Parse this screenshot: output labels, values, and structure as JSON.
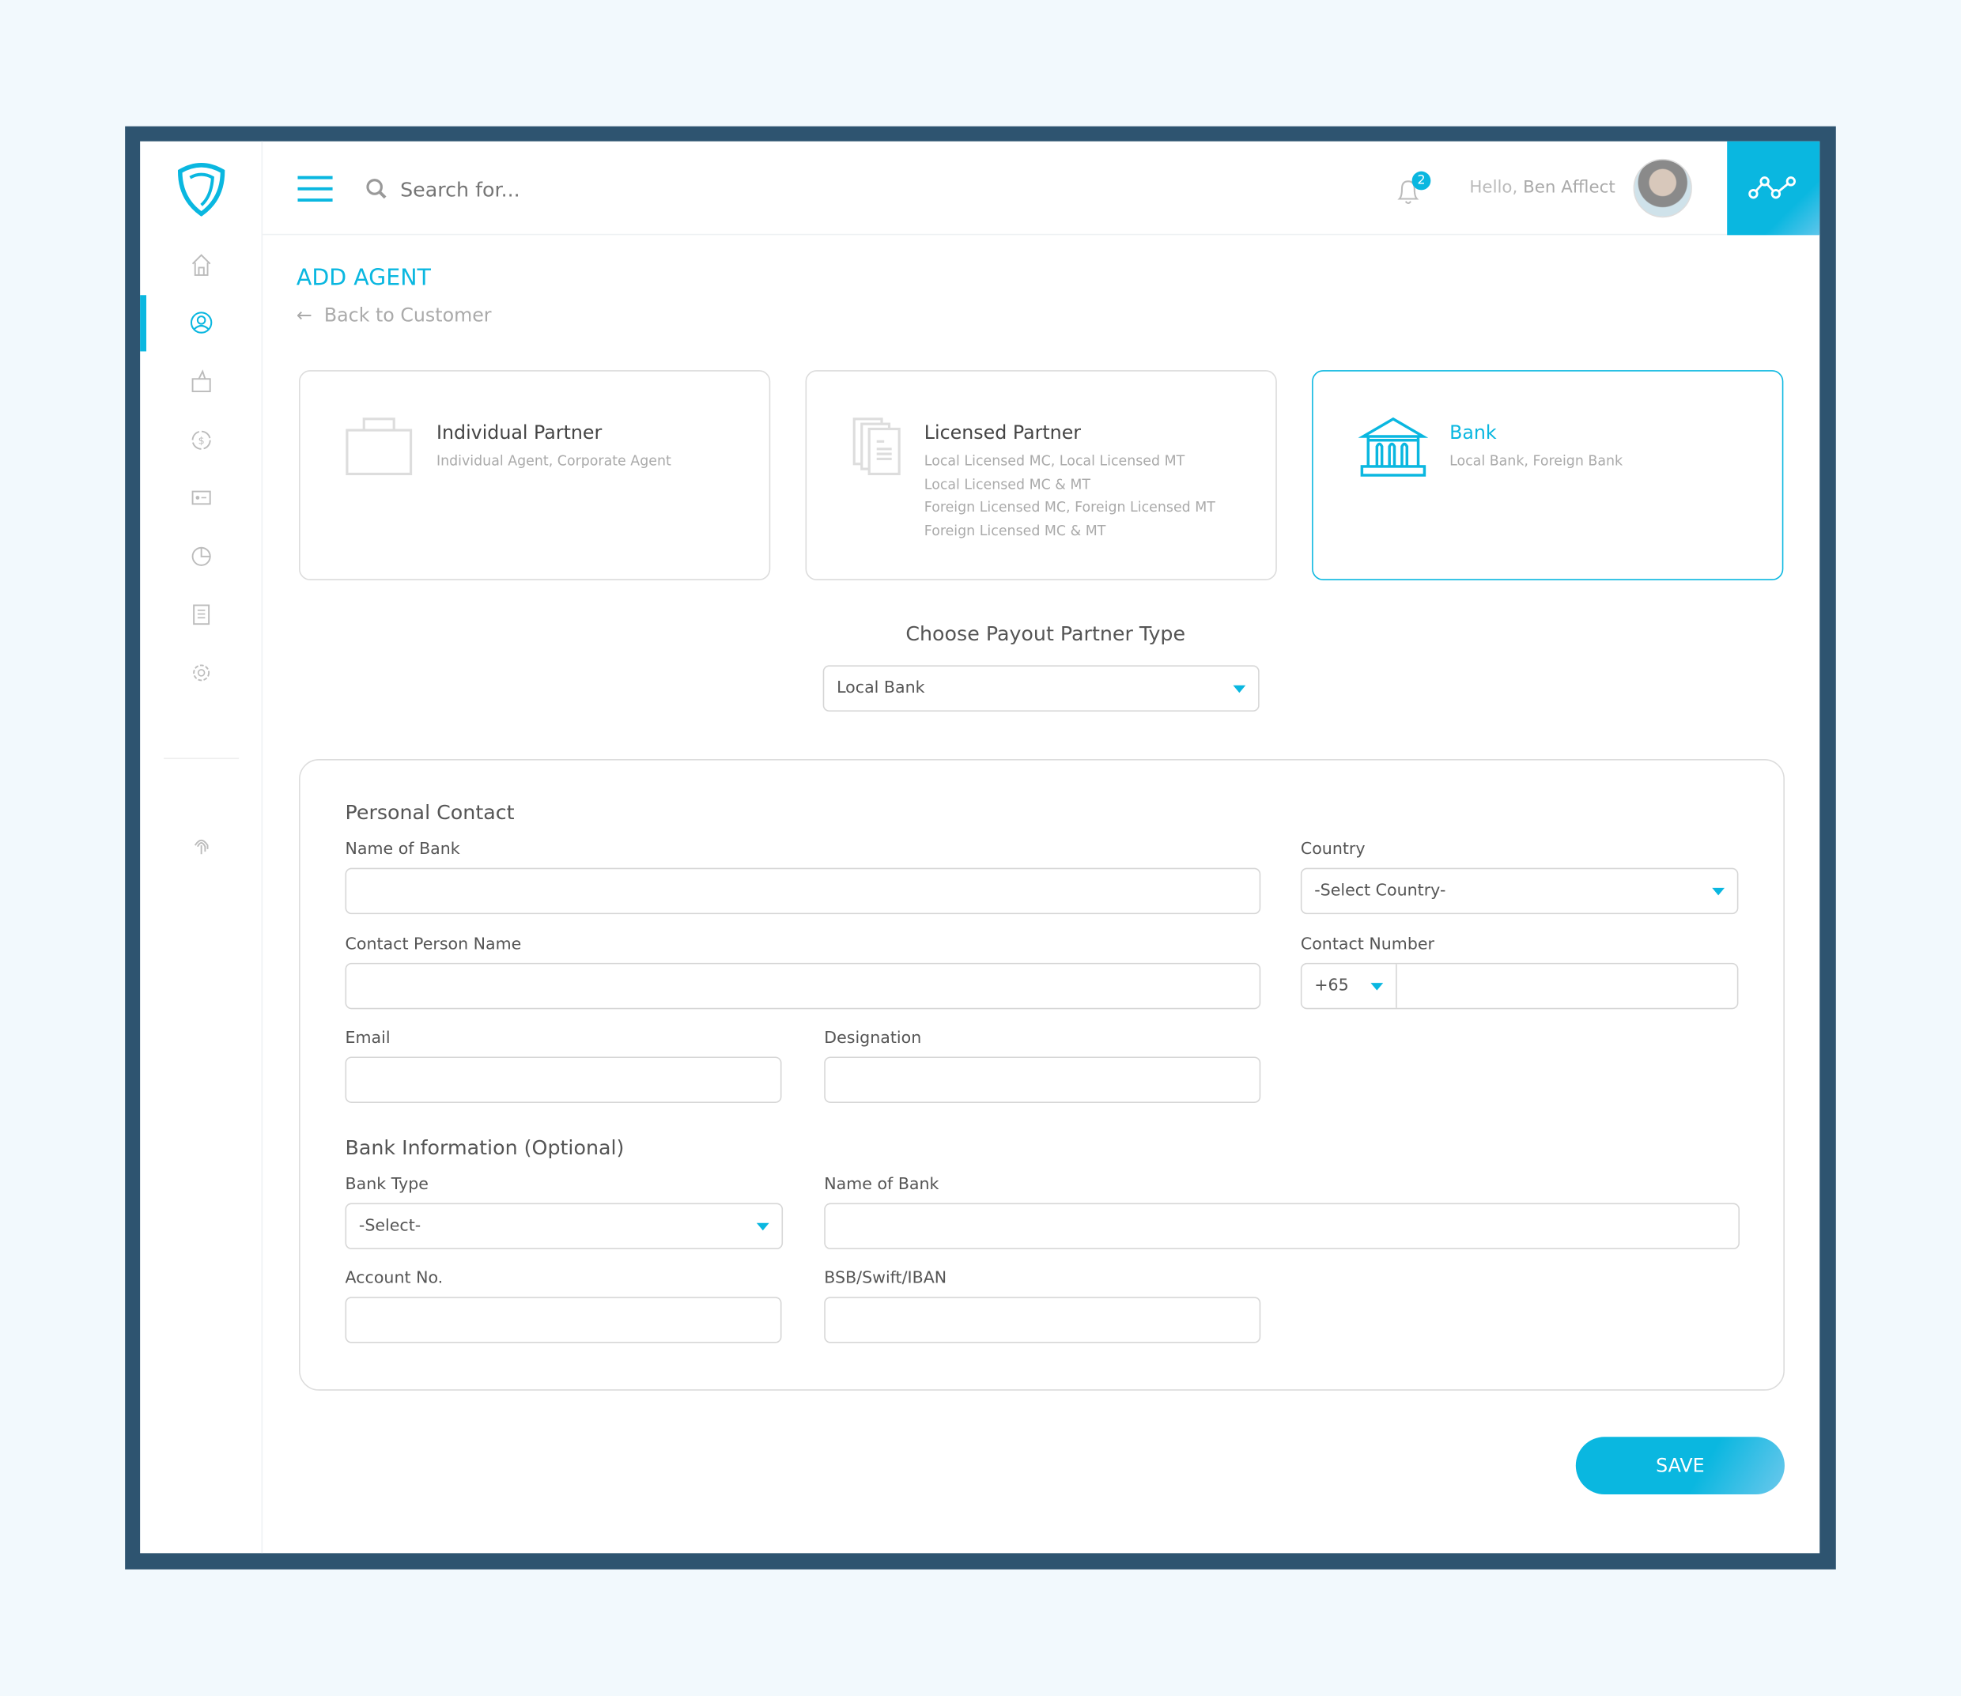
{
  "header": {
    "search_placeholder": "Search for...",
    "notification_count": "2",
    "greeting": "Hello,",
    "user_name": "Ben Afflect"
  },
  "sidebar": {
    "items": [
      "home",
      "customers",
      "wallet",
      "exchange",
      "id-card",
      "reports",
      "documents",
      "settings",
      "fingerprint"
    ],
    "active": "customers"
  },
  "page": {
    "title": "ADD AGENT",
    "back_link": "Back to Customer"
  },
  "partner_cards": [
    {
      "title": "Individual Partner",
      "subtitle": [
        "Individual Agent, Corporate Agent"
      ],
      "icon": "briefcase-icon",
      "selected": false
    },
    {
      "title": "Licensed Partner",
      "subtitle": [
        "Local Licensed MC, Local Licensed MT",
        "Local Licensed MC & MT",
        "Foreign Licensed MC, Foreign Licensed MT",
        "Foreign Licensed MC & MT"
      ],
      "icon": "documents-icon",
      "selected": false
    },
    {
      "title": "Bank",
      "subtitle": [
        "Local Bank, Foreign Bank"
      ],
      "icon": "bank-icon",
      "selected": true
    }
  ],
  "payout": {
    "label": "Choose Payout Partner Type",
    "value": "Local Bank"
  },
  "form": {
    "personal_title": "Personal Contact",
    "name_of_bank": "Name of Bank",
    "country": "Country",
    "country_value": "-Select Country-",
    "contact_person": "Contact Person Name",
    "contact_number": "Contact Number",
    "dial_code": "+65",
    "email": "Email",
    "designation": "Designation",
    "bank_title": "Bank Information (Optional)",
    "bank_type": "Bank Type",
    "bank_type_value": "-Select-",
    "bank_name": "Name of Bank",
    "account_no": "Account No.",
    "bsb": "BSB/Swift/IBAN"
  },
  "save_label": "SAVE",
  "colors": {
    "accent": "#0ab7e0",
    "frame": "#2e5470",
    "background": "#f2f9fd"
  }
}
